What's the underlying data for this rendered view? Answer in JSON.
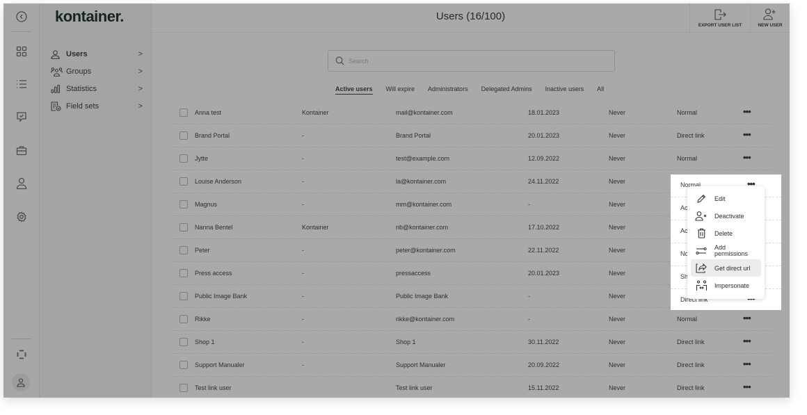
{
  "app": {
    "logo": "kontainer.",
    "title": "Users (16/100)"
  },
  "rail": {
    "icons": [
      "back-icon",
      "dashboard-icon",
      "list-icon",
      "approval-icon",
      "briefcase-icon",
      "user-icon",
      "settings-icon",
      "focus-icon",
      "profile-icon"
    ]
  },
  "subnav": {
    "items": [
      {
        "label": "Users",
        "icon": "user-icon",
        "chevron": ">",
        "active": true
      },
      {
        "label": "Groups",
        "icon": "group-icon",
        "chevron": ">",
        "active": false
      },
      {
        "label": "Statistics",
        "icon": "statistics-icon",
        "chevron": ">",
        "active": false
      },
      {
        "label": "Field sets",
        "icon": "field-sets-icon",
        "chevron": ">",
        "active": false
      }
    ]
  },
  "header": {
    "export_label": "EXPORT USER LIST",
    "new_user_label": "NEW USER"
  },
  "search": {
    "placeholder": "Search",
    "value": ""
  },
  "tabs": [
    {
      "label": "Active users",
      "active": true
    },
    {
      "label": "Will expire",
      "active": false
    },
    {
      "label": "Administrators",
      "active": false
    },
    {
      "label": "Delegated Admins",
      "active": false
    },
    {
      "label": "Inactive users",
      "active": false
    },
    {
      "label": "All",
      "active": false
    }
  ],
  "rows": [
    {
      "name": "Anna test",
      "company": "Kontainer",
      "email": "mail@kontainer.com",
      "created": "18.01.2023",
      "expires": "Never",
      "type": "Normal",
      "more": "•••"
    },
    {
      "name": "Brand Portal",
      "company": "-",
      "email": "Brand Portal",
      "created": "20.01.2023",
      "expires": "Never",
      "type": "Direct link",
      "more": "•••"
    },
    {
      "name": "Jytte",
      "company": "-",
      "email": "test@example.com",
      "created": "12.09.2022",
      "expires": "Never",
      "type": "Normal",
      "more": "•••"
    },
    {
      "name": "Louise Anderson",
      "company": "-",
      "email": "la@kontainer.com",
      "created": "24.11.2022",
      "expires": "Never",
      "type": "Normal",
      "more": "•••"
    },
    {
      "name": "Magnus",
      "company": "-",
      "email": "mm@kontainer.com",
      "created": "-",
      "expires": "Never",
      "type": "Ac",
      "more": "•••"
    },
    {
      "name": "Nanna Bentel",
      "company": "Kontainer",
      "email": "nb@kontainer.com",
      "created": "17.10.2022",
      "expires": "Never",
      "type": "Ac",
      "more": "•••"
    },
    {
      "name": "Peter",
      "company": "-",
      "email": "peter@kontainer.com",
      "created": "22.11.2022",
      "expires": "Never",
      "type": "No",
      "more": "•••"
    },
    {
      "name": "Press access",
      "company": "-",
      "email": "pressaccess",
      "created": "20.01.2023",
      "expires": "Never",
      "type": "Sh",
      "more": "•••"
    },
    {
      "name": "Public Image Bank",
      "company": "-",
      "email": "Public Image Bank",
      "created": "-",
      "expires": "Never",
      "type": "Direct link",
      "more": "•••"
    },
    {
      "name": "Rikke",
      "company": "-",
      "email": "rikke@kontainer.com",
      "created": "-",
      "expires": "Never",
      "type": "Normal",
      "more": "•••"
    },
    {
      "name": "Shop 1",
      "company": "-",
      "email": "Shop 1",
      "created": "30.11.2022",
      "expires": "Never",
      "type": "Direct link",
      "more": "•••"
    },
    {
      "name": "Support Manualer",
      "company": "-",
      "email": "Support Manualer",
      "created": "20.09.2022",
      "expires": "Never",
      "type": "Direct link",
      "more": "•••"
    },
    {
      "name": "Test link user",
      "company": "",
      "email": "Test link user",
      "created": "15.11.2022",
      "expires": "Never",
      "type": "Direct link",
      "more": "•••"
    }
  ],
  "context_menu": {
    "items": [
      {
        "label": "Edit",
        "icon": "pencil-icon",
        "hover": false
      },
      {
        "label": "Deactivate",
        "icon": "user-remove-icon",
        "hover": false
      },
      {
        "label": "Delete",
        "icon": "trash-icon",
        "hover": false
      },
      {
        "label": "Add\npermissions",
        "icon": "permissions-icon",
        "hover": false
      },
      {
        "label": "Get direct url",
        "icon": "share-link-icon",
        "hover": true
      },
      {
        "label": "Impersonate",
        "icon": "impersonate-icon",
        "hover": false
      }
    ]
  }
}
